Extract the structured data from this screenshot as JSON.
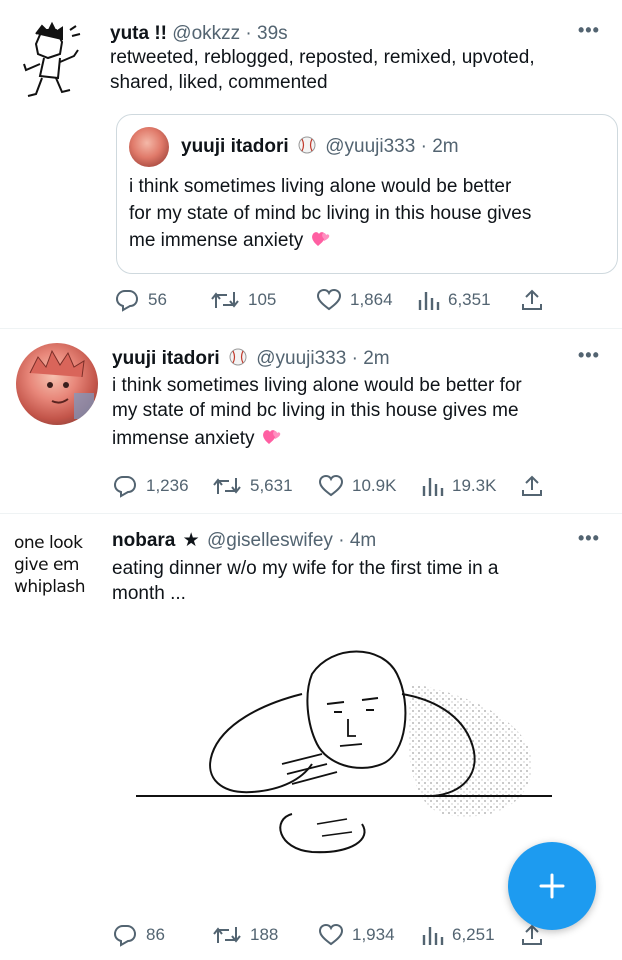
{
  "tweets": [
    {
      "name": "yuta !!",
      "handle": "@okkzz",
      "time": "39s",
      "text_lines": [
        "retweeted, reblogged, reposted, remixed, upvoted,",
        "shared, liked, commented"
      ],
      "quote": {
        "name": "yuuji itadori",
        "handle": "@yuuji333",
        "time": "2m",
        "text_lines": [
          "i think sometimes living alone would be better",
          "for my state of mind bc living in this house gives",
          "me immense anxiety"
        ]
      },
      "stats": {
        "replies": "56",
        "retweets": "105",
        "likes": "1,864",
        "views": "6,351"
      }
    },
    {
      "name": "yuuji itadori",
      "handle": "@yuuji333",
      "time": "2m",
      "text_lines": [
        "i think sometimes living alone would be better for",
        "my state of mind bc living in this house gives me",
        "immense anxiety"
      ],
      "stats": {
        "replies": "1,236",
        "retweets": "5,631",
        "likes": "10.9K",
        "views": "19.3K"
      }
    },
    {
      "name": "nobara",
      "handle": "@giselleswifey",
      "time": "4m",
      "avatar_text": [
        "one look",
        "give em",
        "whiplash"
      ],
      "text_lines": [
        "eating dinner w/o my wife for the first time in a",
        "month ..."
      ],
      "stats": {
        "replies": "86",
        "retweets": "188",
        "likes": "1,934",
        "views": "6,251"
      }
    }
  ],
  "separator": "·",
  "colors": {
    "accent": "#1d9bf0",
    "muted": "#536471",
    "border": "#cfd9de",
    "emoji_heart": "#ff5fa2"
  },
  "icons": [
    "reply-icon",
    "retweet-icon",
    "like-icon",
    "views-icon",
    "share-icon",
    "more-icon",
    "baseball-icon",
    "heart-emoji-icon",
    "plus-icon"
  ]
}
